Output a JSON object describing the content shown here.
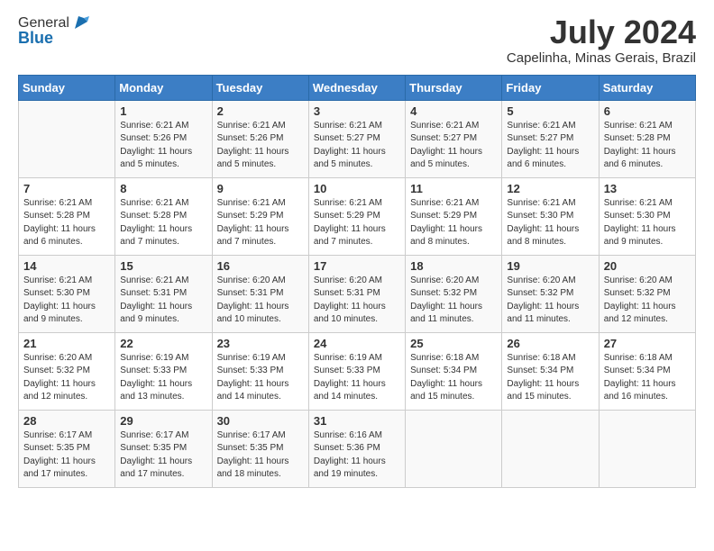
{
  "header": {
    "logo_line1": "General",
    "logo_line2": "Blue",
    "month_title": "July 2024",
    "location": "Capelinha, Minas Gerais, Brazil"
  },
  "days_of_week": [
    "Sunday",
    "Monday",
    "Tuesday",
    "Wednesday",
    "Thursday",
    "Friday",
    "Saturday"
  ],
  "weeks": [
    [
      {
        "num": "",
        "info": ""
      },
      {
        "num": "1",
        "info": "Sunrise: 6:21 AM\nSunset: 5:26 PM\nDaylight: 11 hours\nand 5 minutes."
      },
      {
        "num": "2",
        "info": "Sunrise: 6:21 AM\nSunset: 5:26 PM\nDaylight: 11 hours\nand 5 minutes."
      },
      {
        "num": "3",
        "info": "Sunrise: 6:21 AM\nSunset: 5:27 PM\nDaylight: 11 hours\nand 5 minutes."
      },
      {
        "num": "4",
        "info": "Sunrise: 6:21 AM\nSunset: 5:27 PM\nDaylight: 11 hours\nand 5 minutes."
      },
      {
        "num": "5",
        "info": "Sunrise: 6:21 AM\nSunset: 5:27 PM\nDaylight: 11 hours\nand 6 minutes."
      },
      {
        "num": "6",
        "info": "Sunrise: 6:21 AM\nSunset: 5:28 PM\nDaylight: 11 hours\nand 6 minutes."
      }
    ],
    [
      {
        "num": "7",
        "info": "Sunrise: 6:21 AM\nSunset: 5:28 PM\nDaylight: 11 hours\nand 6 minutes."
      },
      {
        "num": "8",
        "info": "Sunrise: 6:21 AM\nSunset: 5:28 PM\nDaylight: 11 hours\nand 7 minutes."
      },
      {
        "num": "9",
        "info": "Sunrise: 6:21 AM\nSunset: 5:29 PM\nDaylight: 11 hours\nand 7 minutes."
      },
      {
        "num": "10",
        "info": "Sunrise: 6:21 AM\nSunset: 5:29 PM\nDaylight: 11 hours\nand 7 minutes."
      },
      {
        "num": "11",
        "info": "Sunrise: 6:21 AM\nSunset: 5:29 PM\nDaylight: 11 hours\nand 8 minutes."
      },
      {
        "num": "12",
        "info": "Sunrise: 6:21 AM\nSunset: 5:30 PM\nDaylight: 11 hours\nand 8 minutes."
      },
      {
        "num": "13",
        "info": "Sunrise: 6:21 AM\nSunset: 5:30 PM\nDaylight: 11 hours\nand 9 minutes."
      }
    ],
    [
      {
        "num": "14",
        "info": "Sunrise: 6:21 AM\nSunset: 5:30 PM\nDaylight: 11 hours\nand 9 minutes."
      },
      {
        "num": "15",
        "info": "Sunrise: 6:21 AM\nSunset: 5:31 PM\nDaylight: 11 hours\nand 9 minutes."
      },
      {
        "num": "16",
        "info": "Sunrise: 6:20 AM\nSunset: 5:31 PM\nDaylight: 11 hours\nand 10 minutes."
      },
      {
        "num": "17",
        "info": "Sunrise: 6:20 AM\nSunset: 5:31 PM\nDaylight: 11 hours\nand 10 minutes."
      },
      {
        "num": "18",
        "info": "Sunrise: 6:20 AM\nSunset: 5:32 PM\nDaylight: 11 hours\nand 11 minutes."
      },
      {
        "num": "19",
        "info": "Sunrise: 6:20 AM\nSunset: 5:32 PM\nDaylight: 11 hours\nand 11 minutes."
      },
      {
        "num": "20",
        "info": "Sunrise: 6:20 AM\nSunset: 5:32 PM\nDaylight: 11 hours\nand 12 minutes."
      }
    ],
    [
      {
        "num": "21",
        "info": "Sunrise: 6:20 AM\nSunset: 5:32 PM\nDaylight: 11 hours\nand 12 minutes."
      },
      {
        "num": "22",
        "info": "Sunrise: 6:19 AM\nSunset: 5:33 PM\nDaylight: 11 hours\nand 13 minutes."
      },
      {
        "num": "23",
        "info": "Sunrise: 6:19 AM\nSunset: 5:33 PM\nDaylight: 11 hours\nand 14 minutes."
      },
      {
        "num": "24",
        "info": "Sunrise: 6:19 AM\nSunset: 5:33 PM\nDaylight: 11 hours\nand 14 minutes."
      },
      {
        "num": "25",
        "info": "Sunrise: 6:18 AM\nSunset: 5:34 PM\nDaylight: 11 hours\nand 15 minutes."
      },
      {
        "num": "26",
        "info": "Sunrise: 6:18 AM\nSunset: 5:34 PM\nDaylight: 11 hours\nand 15 minutes."
      },
      {
        "num": "27",
        "info": "Sunrise: 6:18 AM\nSunset: 5:34 PM\nDaylight: 11 hours\nand 16 minutes."
      }
    ],
    [
      {
        "num": "28",
        "info": "Sunrise: 6:17 AM\nSunset: 5:35 PM\nDaylight: 11 hours\nand 17 minutes."
      },
      {
        "num": "29",
        "info": "Sunrise: 6:17 AM\nSunset: 5:35 PM\nDaylight: 11 hours\nand 17 minutes."
      },
      {
        "num": "30",
        "info": "Sunrise: 6:17 AM\nSunset: 5:35 PM\nDaylight: 11 hours\nand 18 minutes."
      },
      {
        "num": "31",
        "info": "Sunrise: 6:16 AM\nSunset: 5:36 PM\nDaylight: 11 hours\nand 19 minutes."
      },
      {
        "num": "",
        "info": ""
      },
      {
        "num": "",
        "info": ""
      },
      {
        "num": "",
        "info": ""
      }
    ]
  ]
}
